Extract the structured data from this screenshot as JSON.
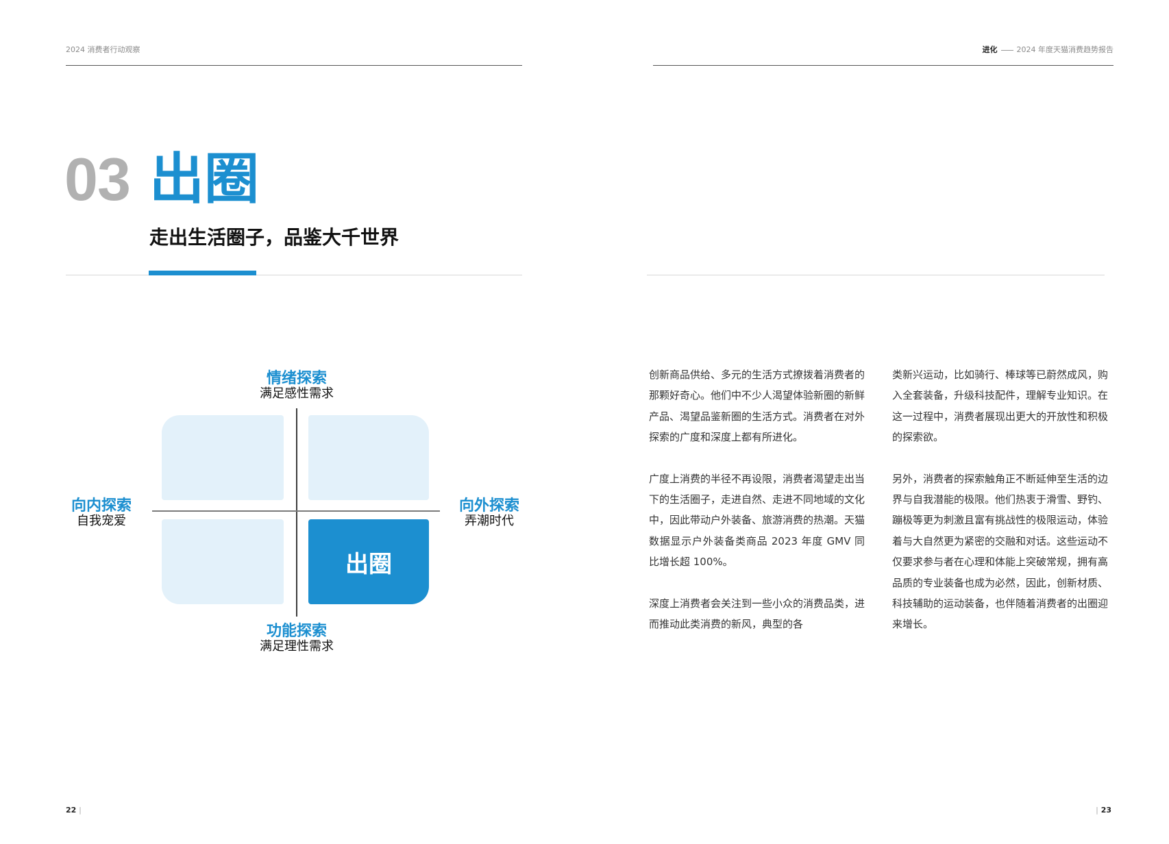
{
  "left_page": {
    "running_head": "2024 消费者行动观察",
    "chapter": {
      "number": "03",
      "title": "出圈",
      "subtitle": "走出生活圈子，品鉴大千世界"
    },
    "diagram": {
      "top": {
        "main": "情绪探索",
        "sub": "满足感性需求"
      },
      "bottom": {
        "main": "功能探索",
        "sub": "满足理性需求"
      },
      "left": {
        "main": "向内探索",
        "sub": "自我宠爱"
      },
      "right": {
        "main": "向外探索",
        "sub": "弄潮时代"
      },
      "highlight_quadrant": "bottom-right",
      "highlight_label": "出圈",
      "colors": {
        "accent": "#1c8fd0",
        "quadrant_fill": "#e3f1fa"
      }
    },
    "page_number": "22"
  },
  "right_page": {
    "running_head": {
      "strong": "进化",
      "rest": "2024 年度天猫消费趋势报告"
    },
    "column1": [
      "创新商品供给、多元的生活方式撩拨着消费者的那颗好奇心。他们中不少人渴望体验新圈的新鲜产品、渴望品鉴新圈的生活方式。消费者在对外探索的广度和深度上都有所进化。",
      "广度上消费的半径不再设限，消费者渴望走出当下的生活圈子，走进自然、走进不同地域的文化中，因此带动户外装备、旅游消费的热潮。天猫数据显示户外装备类商品 2023 年度 GMV 同比增长超 100%。",
      "深度上消费者会关注到一些小众的消费品类，进而推动此类消费的新风，典型的各"
    ],
    "column2": [
      "类新兴运动，比如骑行、棒球等已蔚然成风，购入全套装备，升级科技配件，理解专业知识。在这一过程中，消费者展现出更大的开放性和积极的探索欲。",
      "另外，消费者的探索触角正不断延伸至生活的边界与自我潜能的极限。他们热衷于滑雪、野钓、蹦极等更为刺激且富有挑战性的极限运动，体验着与大自然更为紧密的交融和对话。这些运动不仅要求参与者在心理和体能上突破常规，拥有高品质的专业装备也成为必然，因此，创新材质、科技辅助的运动装备，也伴随着消费者的出圈迎来增长。"
    ],
    "page_number": "23"
  }
}
